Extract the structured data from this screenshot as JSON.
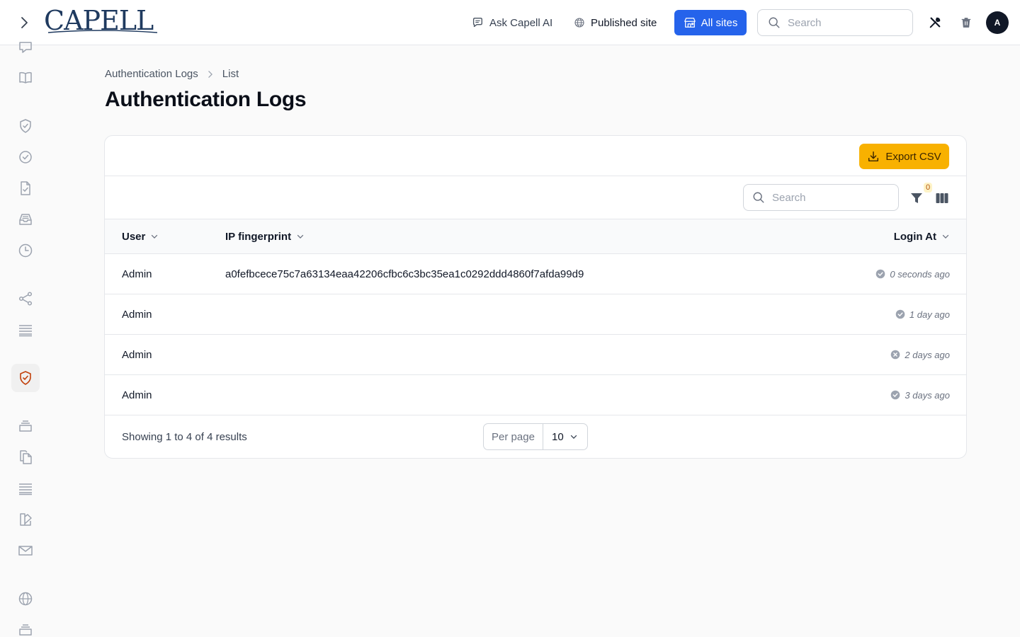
{
  "app": {
    "logo_text": "CAPELL"
  },
  "topbar": {
    "ask_ai_label": "Ask Capell AI",
    "published_site_label": "Published site",
    "all_sites_label": "All sites",
    "search_placeholder": "Search",
    "avatar_initial": "A"
  },
  "sidebar": {
    "icons": [
      "chat-bubbles-icon",
      "book-icon",
      "shield-check-icon",
      "check-circle-icon",
      "document-check-icon",
      "inbox-icon",
      "clock-icon",
      "share-icon",
      "queue-list-icon",
      "shield-check-icon",
      "stack-icon",
      "documents-icon",
      "queue-list-icon",
      "swatch-icon",
      "envelope-icon",
      "globe-icon",
      "stack-icon"
    ],
    "active_index": 9,
    "active_color": "#c2410c"
  },
  "breadcrumb": {
    "parent": "Authentication Logs",
    "current": "List"
  },
  "page": {
    "title": "Authentication Logs"
  },
  "table": {
    "export_label": "Export CSV",
    "search_placeholder": "Search",
    "filter_count": "0",
    "columns": {
      "user": "User",
      "ip": "IP fingerprint",
      "login_at": "Login At"
    },
    "rows": [
      {
        "user": "Admin",
        "ip": "a0fefbcece75c7a63134eaa42206cfbc6c3bc35ea1c0292ddd4860f7afda99d9",
        "login_at": "0 seconds ago",
        "status": "success"
      },
      {
        "user": "Admin",
        "ip": "",
        "login_at": "1 day ago",
        "status": "success"
      },
      {
        "user": "Admin",
        "ip": "",
        "login_at": "2 days ago",
        "status": "failed"
      },
      {
        "user": "Admin",
        "ip": "",
        "login_at": "3 days ago",
        "status": "success"
      }
    ],
    "results_text": "Showing 1 to 4 of 4 results",
    "per_page_label": "Per page",
    "per_page_value": "10"
  },
  "colors": {
    "primary": "#2563eb",
    "accent": "#f8b100",
    "status_icon": "#9ca3af"
  }
}
